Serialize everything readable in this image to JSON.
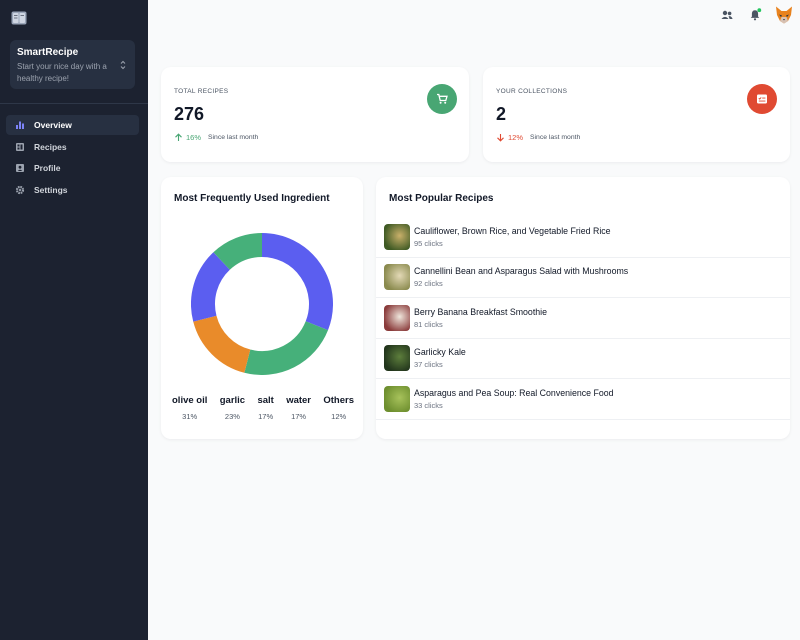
{
  "app": {
    "name": "SmartRecipe",
    "tagline": "Start your nice day with a healthy recipe!"
  },
  "nav": [
    {
      "label": "Overview",
      "icon": "bar-chart-icon",
      "active": true
    },
    {
      "label": "Recipes",
      "icon": "table-icon",
      "active": false
    },
    {
      "label": "Profile",
      "icon": "id-card-icon",
      "active": false
    },
    {
      "label": "Settings",
      "icon": "gear-icon",
      "active": false
    }
  ],
  "topbar": {
    "icons": [
      "users-icon",
      "bell-icon"
    ],
    "notification_dot_color": "#22c55e"
  },
  "stats": {
    "total_recipes": {
      "label": "TOTAL RECIPES",
      "value": "276",
      "change": "16%",
      "direction": "up",
      "since": "Since last month",
      "badge_color": "#48a673",
      "icon": "cart-icon"
    },
    "collections": {
      "label": "YOUR COLLECTIONS",
      "value": "2",
      "change": "12%",
      "direction": "down",
      "since": "Since last month",
      "badge_color": "#e04a32",
      "icon": "checklist-icon"
    }
  },
  "ingredients": {
    "title": "Most Frequently Used Ingredient",
    "items": [
      {
        "name": "olive oil",
        "pct": "31%"
      },
      {
        "name": "garlic",
        "pct": "23%"
      },
      {
        "name": "salt",
        "pct": "17%"
      },
      {
        "name": "water",
        "pct": "17%"
      },
      {
        "name": "Others",
        "pct": "12%"
      }
    ]
  },
  "chart_data": {
    "type": "pie",
    "categories": [
      "olive oil",
      "garlic",
      "salt",
      "water",
      "Others"
    ],
    "values": [
      31,
      23,
      17,
      17,
      12
    ],
    "colors": [
      "#5b5ef0",
      "#46b07a",
      "#e98b2a",
      "#5b5ef0",
      "#46b07a"
    ]
  },
  "popular": {
    "title": "Most Popular Recipes",
    "recipes": [
      {
        "name": "Cauliflower, Brown Rice, and Vegetable Fried Rice",
        "clicks": "95 clicks",
        "thumb": [
          "#3f5a24",
          "#c9b06a"
        ]
      },
      {
        "name": "Cannellini Bean and Asparagus Salad with Mushrooms",
        "clicks": "92 clicks",
        "thumb": [
          "#8a8a4e",
          "#e3d9b6"
        ]
      },
      {
        "name": "Berry Banana Breakfast Smoothie",
        "clicks": "81 clicks",
        "thumb": [
          "#8a3b3b",
          "#efe6dc"
        ]
      },
      {
        "name": "Garlicky Kale",
        "clicks": "37 clicks",
        "thumb": [
          "#22351c",
          "#5d7e3c"
        ]
      },
      {
        "name": "Asparagus and Pea Soup: Real Convenience Food",
        "clicks": "33 clicks",
        "thumb": [
          "#6e8f2f",
          "#a7c25b"
        ]
      }
    ]
  }
}
